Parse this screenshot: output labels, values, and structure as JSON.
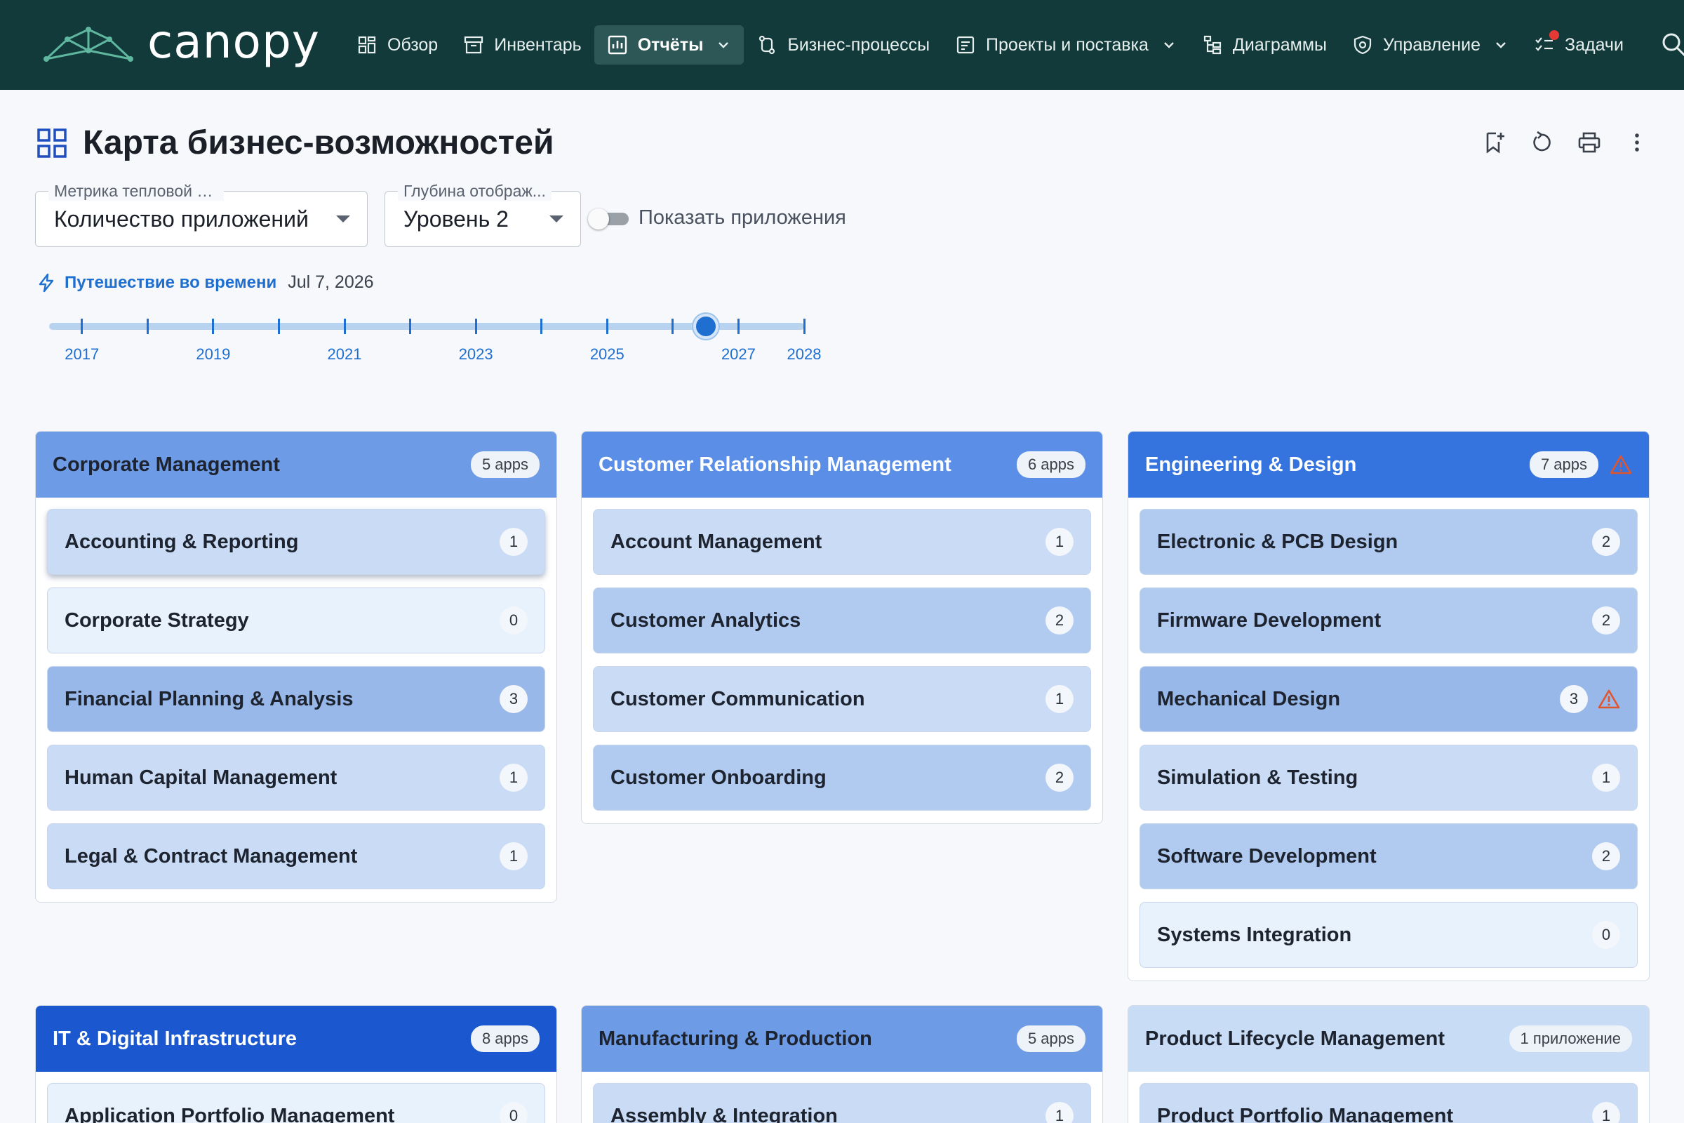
{
  "brand": {
    "name": "canopy"
  },
  "nav": [
    {
      "label": "Обзор",
      "icon": "dashboard-icon",
      "active": false,
      "chevron": false
    },
    {
      "label": "Инвентарь",
      "icon": "archive-icon",
      "active": false,
      "chevron": false
    },
    {
      "label": "Отчёты",
      "icon": "report-icon",
      "active": true,
      "chevron": true
    },
    {
      "label": "Бизнес-процессы",
      "icon": "process-icon",
      "active": false,
      "chevron": false
    },
    {
      "label": "Проекты и поставка",
      "icon": "project-icon",
      "active": false,
      "chevron": true
    },
    {
      "label": "Диаграммы",
      "icon": "diagram-icon",
      "active": false,
      "chevron": false
    },
    {
      "label": "Управление",
      "icon": "shield-icon",
      "active": false,
      "chevron": true
    },
    {
      "label": "Задачи",
      "icon": "tasks-icon",
      "active": false,
      "chevron": false,
      "notification": true
    }
  ],
  "page": {
    "title": "Карта бизнес-возможностей"
  },
  "filters": {
    "metric": {
      "legend": "Метрика тепловой карты",
      "value": "Количество приложений"
    },
    "depth": {
      "legend": "Глубина отображ...",
      "value": "Уровень 2"
    },
    "show_apps": {
      "label": "Показать приложения",
      "on": false
    }
  },
  "time_travel": {
    "label": "Путешествие во времени",
    "date": "Jul 7, 2026",
    "years": [
      "2017",
      "2019",
      "2021",
      "2023",
      "2025",
      "2027",
      "2028"
    ],
    "thumb_year": 2026.5
  },
  "colors": {
    "heat_0": "#e8f2fd",
    "heat_1": "#cadcf5",
    "heat_2": "#b1caf0",
    "heat_3": "#99b8ea",
    "head_light": "#c8dcf5",
    "head_5": "#6e9be6",
    "head_6": "#5b8ee6",
    "head_7": "#3574de",
    "head_8": "#1b57cf",
    "warning": "#e0552c"
  },
  "groups": [
    {
      "title": "Corporate Management",
      "badge": "5 apps",
      "head": "head_5",
      "warn": false,
      "items": [
        {
          "label": "Accounting & Reporting",
          "count": "1",
          "heat": "heat_1",
          "warn": false,
          "shadow": true
        },
        {
          "label": "Corporate Strategy",
          "count": "0",
          "heat": "heat_0",
          "warn": false
        },
        {
          "label": "Financial Planning & Analysis",
          "count": "3",
          "heat": "heat_3",
          "warn": false
        },
        {
          "label": "Human Capital Management",
          "count": "1",
          "heat": "heat_1",
          "warn": false
        },
        {
          "label": "Legal & Contract Management",
          "count": "1",
          "heat": "heat_1",
          "warn": false
        }
      ]
    },
    {
      "title": "Customer Relationship Management",
      "badge": "6 apps",
      "head": "head_6",
      "warn": false,
      "items": [
        {
          "label": "Account Management",
          "count": "1",
          "heat": "heat_1",
          "warn": false
        },
        {
          "label": "Customer Analytics",
          "count": "2",
          "heat": "heat_2",
          "warn": false
        },
        {
          "label": "Customer Communication",
          "count": "1",
          "heat": "heat_1",
          "warn": false
        },
        {
          "label": "Customer Onboarding",
          "count": "2",
          "heat": "heat_2",
          "warn": false
        }
      ]
    },
    {
      "title": "Engineering & Design",
      "badge": "7 apps",
      "head": "head_7",
      "warn": true,
      "items": [
        {
          "label": "Electronic & PCB Design",
          "count": "2",
          "heat": "heat_2",
          "warn": false
        },
        {
          "label": "Firmware Development",
          "count": "2",
          "heat": "heat_2",
          "warn": false
        },
        {
          "label": "Mechanical Design",
          "count": "3",
          "heat": "heat_3",
          "warn": true
        },
        {
          "label": "Simulation & Testing",
          "count": "1",
          "heat": "heat_1",
          "warn": false
        },
        {
          "label": "Software Development",
          "count": "2",
          "heat": "heat_2",
          "warn": false
        },
        {
          "label": "Systems Integration",
          "count": "0",
          "heat": "heat_0",
          "warn": false
        }
      ]
    },
    {
      "title": "IT & Digital Infrastructure",
      "badge": "8 apps",
      "head": "head_8",
      "warn": false,
      "items": [
        {
          "label": "Application Portfolio Management",
          "count": "0",
          "heat": "heat_0",
          "warn": false
        }
      ]
    },
    {
      "title": "Manufacturing & Production",
      "badge": "5 apps",
      "head": "head_5",
      "warn": false,
      "items": [
        {
          "label": "Assembly & Integration",
          "count": "1",
          "heat": "heat_1",
          "warn": false
        }
      ]
    },
    {
      "title": "Product Lifecycle Management",
      "badge": "1 приложение",
      "head": "head_light",
      "warn": false,
      "items": [
        {
          "label": "Product Portfolio Management",
          "count": "1",
          "heat": "heat_1",
          "warn": false
        }
      ]
    }
  ]
}
